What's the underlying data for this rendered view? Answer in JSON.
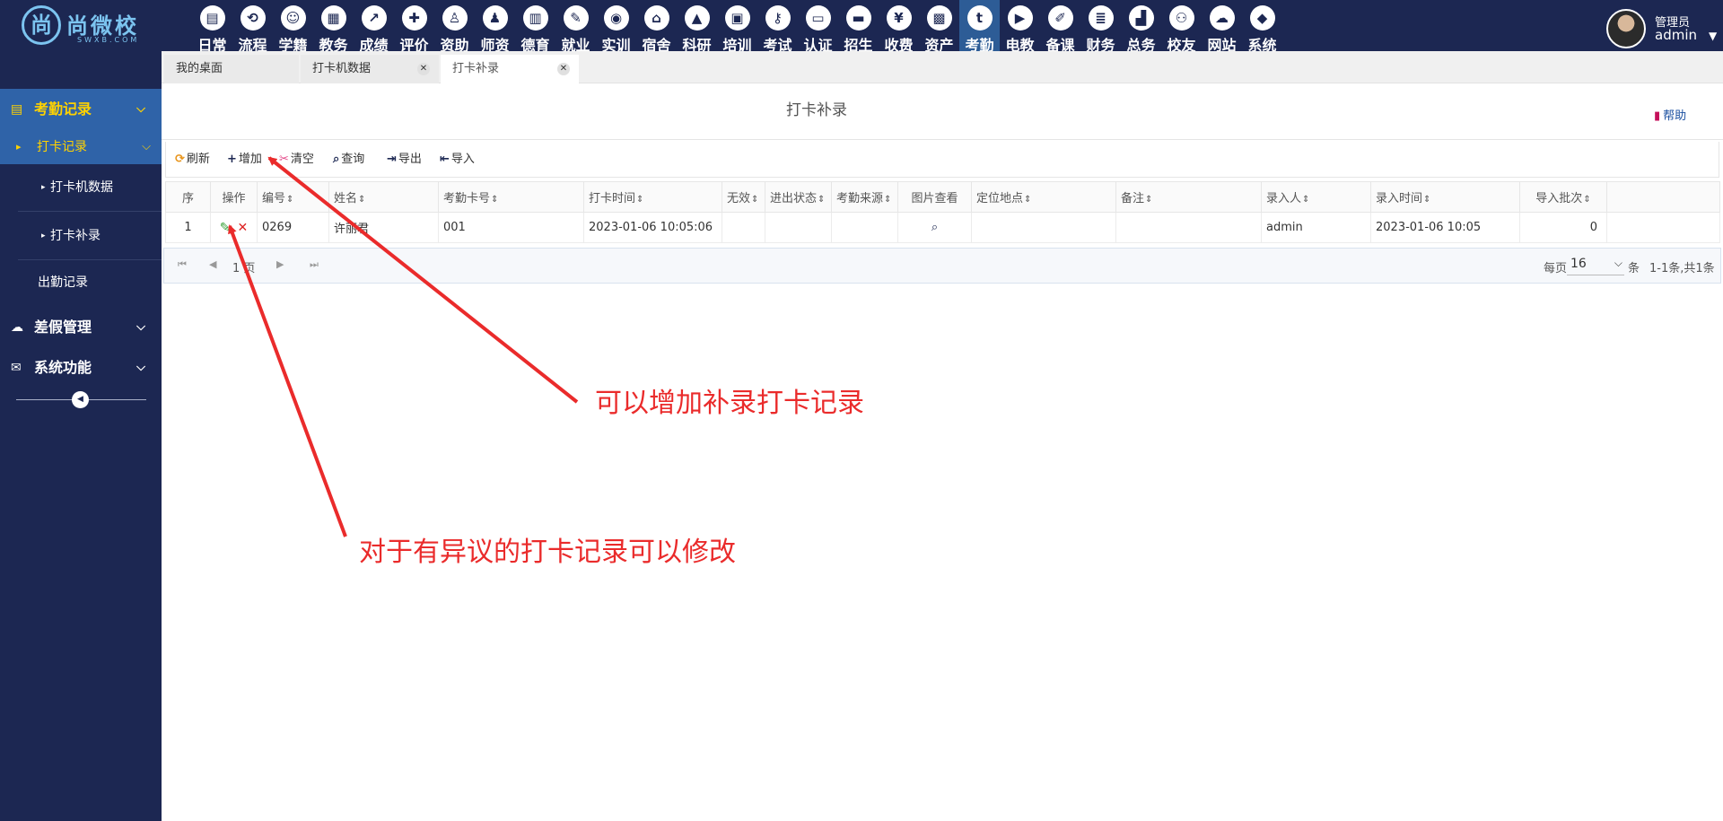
{
  "app": {
    "logo_text": "尚微校",
    "logo_sub": "SWXB.COM",
    "logo_mark": "尚"
  },
  "modules": [
    {
      "label": "日常",
      "icon": "file-icon",
      "glyph": "▤"
    },
    {
      "label": "流程",
      "icon": "workflow-icon",
      "glyph": "⟲"
    },
    {
      "label": "学籍",
      "icon": "student-icon",
      "glyph": "☺"
    },
    {
      "label": "教务",
      "icon": "calendar-icon",
      "glyph": "▦"
    },
    {
      "label": "成绩",
      "icon": "chart-line-icon",
      "glyph": "↗"
    },
    {
      "label": "评价",
      "icon": "calendar-plus-icon",
      "glyph": "✚"
    },
    {
      "label": "资助",
      "icon": "user-support-icon",
      "glyph": "♙"
    },
    {
      "label": "师资",
      "icon": "teacher-icon",
      "glyph": "♟"
    },
    {
      "label": "德育",
      "icon": "book-icon",
      "glyph": "▥"
    },
    {
      "label": "就业",
      "icon": "hammer-icon",
      "glyph": "✎"
    },
    {
      "label": "实训",
      "icon": "robot-icon",
      "glyph": "◉"
    },
    {
      "label": "宿舍",
      "icon": "home-icon",
      "glyph": "⌂"
    },
    {
      "label": "科研",
      "icon": "graduation-cap-icon",
      "glyph": "▲"
    },
    {
      "label": "培训",
      "icon": "image-icon",
      "glyph": "▣"
    },
    {
      "label": "考试",
      "icon": "key-icon",
      "glyph": "⚷"
    },
    {
      "label": "认证",
      "icon": "monitor-icon",
      "glyph": "▭"
    },
    {
      "label": "招生",
      "icon": "bus-icon",
      "glyph": "▬"
    },
    {
      "label": "收费",
      "icon": "yen-icon",
      "glyph": "¥"
    },
    {
      "label": "资产",
      "icon": "train-icon",
      "glyph": "▩"
    },
    {
      "label": "考勤",
      "icon": "tumblr-icon",
      "glyph": "t"
    },
    {
      "label": "电教",
      "icon": "video-file-icon",
      "glyph": "▶"
    },
    {
      "label": "备课",
      "icon": "edit-icon",
      "glyph": "✐"
    },
    {
      "label": "财务",
      "icon": "newspaper-icon",
      "glyph": "≣"
    },
    {
      "label": "总务",
      "icon": "bar-chart-icon",
      "glyph": "▟"
    },
    {
      "label": "校友",
      "icon": "users-icon",
      "glyph": "⚇"
    },
    {
      "label": "网站",
      "icon": "cloud-icon",
      "glyph": "☁"
    },
    {
      "label": "系统",
      "icon": "cube-icon",
      "glyph": "◆"
    }
  ],
  "active_module": "考勤",
  "user": {
    "role": "管理员",
    "name": "admin"
  },
  "sidebar": {
    "group1": "考勤记录",
    "sub1": "打卡记录",
    "leaf1": "打卡机数据",
    "leaf2": "打卡补录",
    "plain1": "出勤记录",
    "group2": "差假管理",
    "group3": "系统功能"
  },
  "tabs": [
    {
      "label": "我的桌面"
    },
    {
      "label": "打卡机数据"
    },
    {
      "label": "打卡补录"
    }
  ],
  "page": {
    "title": "打卡补录",
    "help": "帮助"
  },
  "toolbar": {
    "refresh": "刷新",
    "add": "增加",
    "clear": "清空",
    "query": "查询",
    "export": "导出",
    "import": "导入"
  },
  "table": {
    "columns": [
      "序",
      "操作",
      "编号",
      "姓名",
      "考勤卡号",
      "打卡时间",
      "无效",
      "进出状态",
      "考勤来源",
      "图片查看",
      "定位地点",
      "备注",
      "录入人",
      "录入时间",
      "导入批次"
    ],
    "rows": [
      {
        "seq": "1",
        "id": "0269",
        "name": "许丽君",
        "card": "001",
        "time": "2023-01-06 10:05:06",
        "invalid": "",
        "inout": "",
        "source": "",
        "location": "",
        "remark": "",
        "entered_by": "admin",
        "entered_time": "2023-01-06 10:05",
        "batch": "0"
      }
    ]
  },
  "pager": {
    "page_text": "1 页",
    "per_page_label": "每页",
    "page_size": "16",
    "unit": "条",
    "summary": "1-1条,共1条"
  },
  "annotations": {
    "add_note": "可以增加补录打卡记录",
    "edit_note": "对于有异议的打卡记录可以修改",
    "color": "#ea2b2b"
  }
}
